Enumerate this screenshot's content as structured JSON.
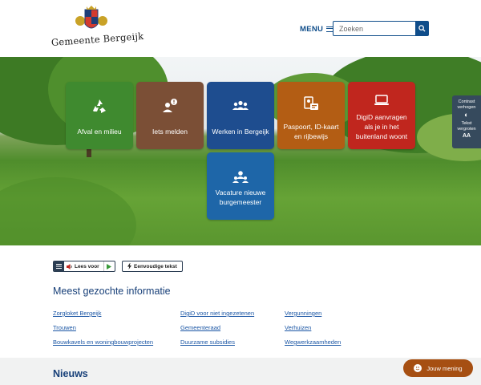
{
  "header": {
    "logo_text": "Gemeente Bergeijk",
    "menu_label": "MENU",
    "search_placeholder": "Zoeken",
    "search_icon": "magnifier-icon"
  },
  "tiles": [
    {
      "label": "Afval en milieu",
      "color": "#3f8a2f",
      "icon": "recycle-icon"
    },
    {
      "label": "Iets melden",
      "color": "#7b4f36",
      "icon": "report-person-icon"
    },
    {
      "label": "Werken in Bergeijk",
      "color": "#1e4d8f",
      "icon": "group-icon"
    },
    {
      "label": "Paspoort, ID-kaart en rijbewijs",
      "color": "#b35d14",
      "icon": "id-card-icon"
    },
    {
      "label": "DigiD aanvragen als je in het buitenland woont",
      "color": "#c0261e",
      "icon": "laptop-icon"
    },
    {
      "label": "Vacature nieuwe burgemeester",
      "color": "#1e66a8",
      "icon": "team-badge-icon"
    }
  ],
  "side_panel": {
    "contrast": "Contrast verhogen",
    "text_size": "Tekst vergroten",
    "text_glyph": "AA"
  },
  "readbar": {
    "read_label": "Lees voor",
    "simple_text": "Eenvoudige tekst"
  },
  "info": {
    "title": "Meest gezochte informatie",
    "links": [
      "Zorgloket Bergeijk",
      "DigiD voor niet ingezetenen",
      "Vergunningen",
      "Trouwen",
      "Gemeenteraad",
      "Verhuizen",
      "Bouwkavels en woningbouwprojecten",
      "Duurzame subsidies",
      "Wegwerkzaamheden"
    ]
  },
  "news": {
    "title": "Nieuws"
  },
  "feedback": {
    "label": "Jouw mening"
  }
}
